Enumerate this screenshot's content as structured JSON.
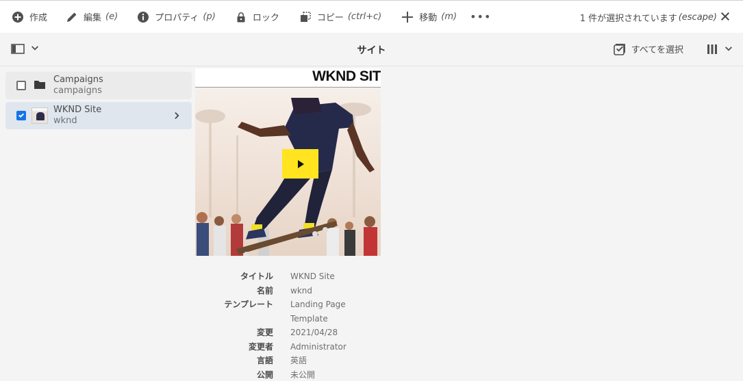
{
  "actionbar": {
    "create": {
      "label": "作成",
      "icon": "add-circle-icon"
    },
    "edit": {
      "label": "編集",
      "shortcut": "(e)",
      "icon": "pencil-icon"
    },
    "properties": {
      "label": "プロパティ",
      "shortcut": "(p)",
      "icon": "info-icon"
    },
    "lock": {
      "label": "ロック",
      "icon": "lock-icon"
    },
    "copy": {
      "label": "コピー",
      "shortcut": "(ctrl+c)",
      "icon": "copy-icon"
    },
    "move": {
      "label": "移動",
      "shortcut": "(m)",
      "icon": "move-icon"
    },
    "more": "•••",
    "selection_text": "1 件が選択されています",
    "selection_shortcut": "(escape)"
  },
  "viewbar": {
    "title": "サイト",
    "select_all": "すべてを選択"
  },
  "column": {
    "items": [
      {
        "title": "Campaigns",
        "name": "campaigns",
        "selected": false,
        "icon": "folder-icon"
      },
      {
        "title": "WKND Site",
        "name": "wknd",
        "selected": true,
        "icon": "thumbnail-image"
      }
    ]
  },
  "preview": {
    "brand": "WKND SIT",
    "metadata": [
      {
        "label": "タイトル",
        "value": "WKND Site"
      },
      {
        "label": "名前",
        "value": "wknd"
      },
      {
        "label": "テンプレート",
        "value": "Landing Page Template"
      },
      {
        "label": "変更",
        "value": "2021/04/28"
      },
      {
        "label": "変更者",
        "value": "Administrator"
      },
      {
        "label": "言語",
        "value": "英語"
      },
      {
        "label": "公開",
        "value": "未公開"
      }
    ]
  },
  "colors": {
    "accent": "#1473e6",
    "selected_row": "#dfe6ee",
    "play_button": "#ffe41f"
  }
}
